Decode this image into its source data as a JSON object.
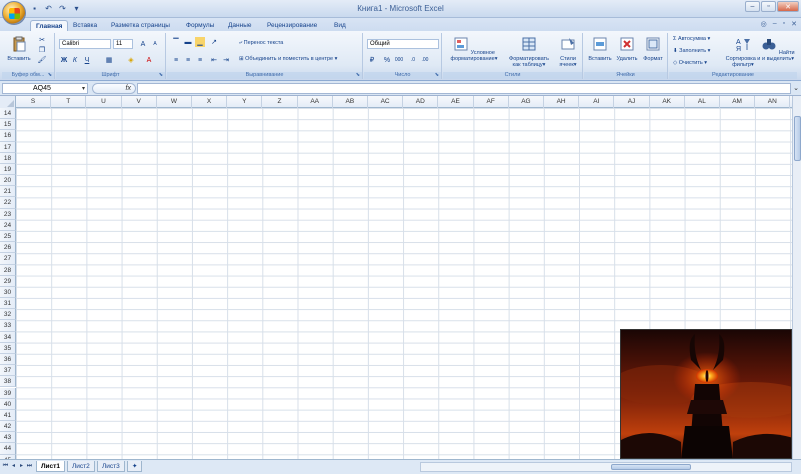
{
  "window": {
    "title": "Книга1 - Microsoft Excel"
  },
  "qat": {
    "save_icon": "save-icon",
    "undo_icon": "undo-icon",
    "redo_icon": "redo-icon"
  },
  "tabs": [
    {
      "label": "Главная",
      "active": true
    },
    {
      "label": "Вставка"
    },
    {
      "label": "Разметка страницы"
    },
    {
      "label": "Формулы"
    },
    {
      "label": "Данные"
    },
    {
      "label": "Рецензирование"
    },
    {
      "label": "Вид"
    }
  ],
  "ribbon": {
    "clipboard": {
      "paste": "Вставить",
      "label": "Буфер обм..."
    },
    "font": {
      "name": "Calibri",
      "size": "11",
      "label": "Шрифт"
    },
    "alignment": {
      "wrap": "Перенос текста",
      "merge": "Объединить и поместить в центре",
      "label": "Выравнивание"
    },
    "number": {
      "format": "Общий",
      "label": "Число"
    },
    "styles": {
      "conditional": "Условное форматирование",
      "table": "Форматировать как таблицу",
      "cell": "Стили ячеек",
      "label": "Стили"
    },
    "cells": {
      "insert": "Вставить",
      "delete": "Удалить",
      "format": "Формат",
      "label": "Ячейки"
    },
    "editing": {
      "autosum": "Автосумма",
      "fill": "Заполнить",
      "clear": "Очистить",
      "sort": "Сортировка и фильтр",
      "find": "Найти и выделить",
      "label": "Редактирование"
    }
  },
  "formula_bar": {
    "name_box": "AQ45",
    "fx": "fx",
    "value": ""
  },
  "columns": [
    "S",
    "T",
    "U",
    "V",
    "W",
    "X",
    "Y",
    "Z",
    "AA",
    "AB",
    "AC",
    "AD",
    "AE",
    "AF",
    "AG",
    "AH",
    "AI",
    "AJ",
    "AK",
    "AL",
    "AM",
    "AN"
  ],
  "rows": [
    "14",
    "15",
    "16",
    "17",
    "18",
    "19",
    "20",
    "21",
    "22",
    "23",
    "24",
    "25",
    "26",
    "27",
    "28",
    "29",
    "30",
    "31",
    "32",
    "33",
    "34",
    "35",
    "36",
    "37",
    "38",
    "39",
    "40",
    "41",
    "42",
    "43",
    "44",
    "45"
  ],
  "sheets": [
    {
      "label": "Лист1",
      "active": true
    },
    {
      "label": "Лист2"
    },
    {
      "label": "Лист3"
    }
  ],
  "colors": {
    "accent": "#15428b",
    "ribbon": "#dfe9f5"
  }
}
